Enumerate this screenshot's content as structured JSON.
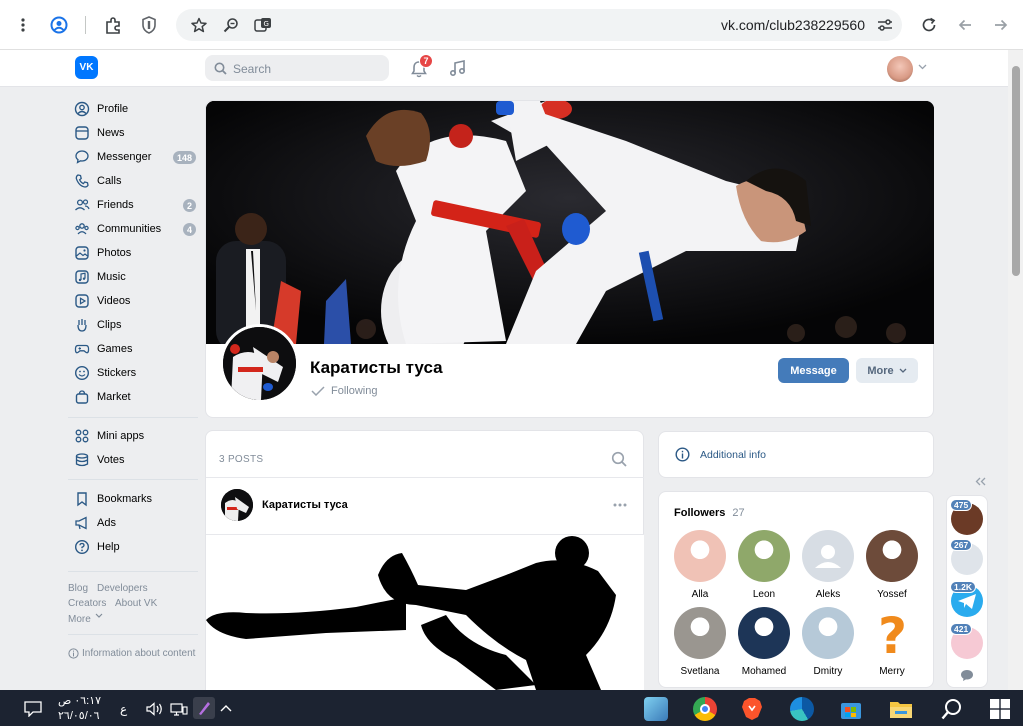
{
  "browser": {
    "url": "vk.com/club238229560",
    "icons": [
      "menu-dots-icon",
      "account-icon",
      "extensions-icon",
      "shield-icon",
      "star-icon",
      "zoom-icon",
      "translate-icon",
      "site-settings-icon",
      "reload-icon",
      "back-icon",
      "forward-icon"
    ]
  },
  "header": {
    "logo_text": "VK",
    "search_placeholder": "Search",
    "notifications_count": "7"
  },
  "sidebar": {
    "items": [
      {
        "label": "Profile",
        "icon": "user-circle-icon"
      },
      {
        "label": "News",
        "icon": "news-icon"
      },
      {
        "label": "Messenger",
        "icon": "chat-icon",
        "badge": "148"
      },
      {
        "label": "Calls",
        "icon": "phone-icon"
      },
      {
        "label": "Friends",
        "icon": "friends-icon",
        "badge": "2"
      },
      {
        "label": "Communities",
        "icon": "communities-icon",
        "badge": "4"
      },
      {
        "label": "Photos",
        "icon": "photo-icon"
      },
      {
        "label": "Music",
        "icon": "music-icon"
      },
      {
        "label": "Videos",
        "icon": "video-icon"
      },
      {
        "label": "Clips",
        "icon": "clips-icon"
      },
      {
        "label": "Games",
        "icon": "gamepad-icon"
      },
      {
        "label": "Stickers",
        "icon": "smile-icon"
      },
      {
        "label": "Market",
        "icon": "bag-icon"
      }
    ],
    "items2": [
      {
        "label": "Mini apps",
        "icon": "grid-icon"
      },
      {
        "label": "Votes",
        "icon": "database-icon"
      }
    ],
    "items3": [
      {
        "label": "Bookmarks",
        "icon": "bookmark-icon"
      },
      {
        "label": "Ads",
        "icon": "megaphone-icon"
      },
      {
        "label": "Help",
        "icon": "help-icon"
      }
    ],
    "footer": {
      "blog": "Blog",
      "developers": "Developers",
      "creators": "Creators",
      "about": "About VK",
      "more": "More",
      "info": "Information about content"
    }
  },
  "group": {
    "name": "Каратисты туса",
    "following": "Following",
    "message_button": "Message",
    "more_button": "More"
  },
  "wall": {
    "posts_count_label": "3 POSTS",
    "post_author": "Каратисты туса"
  },
  "info": {
    "additional_info": "Additional info"
  },
  "followers": {
    "title": "Followers",
    "count": "27",
    "people": [
      {
        "name": "Alla",
        "color": "#f0c2b6"
      },
      {
        "name": "Leon",
        "color": "#8fa86a"
      },
      {
        "name": "Aleks",
        "color": "#d7dde4"
      },
      {
        "name": "Yossef",
        "color": "#6d4b3a"
      },
      {
        "name": "Svetlana",
        "color": "#9a9690"
      },
      {
        "name": "Mohamed",
        "color": "#1d3557"
      },
      {
        "name": "Dmitry",
        "color": "#b6c9d8"
      },
      {
        "name": "Merry",
        "color": "#f08a1c"
      }
    ]
  },
  "right_rail": {
    "badges": [
      "475",
      "267",
      "1.2K",
      "421"
    ]
  },
  "taskbar": {
    "time": "٠٦:١٧ ص",
    "date": "٢٦/٠٥/٠٦",
    "lang": "ع"
  }
}
